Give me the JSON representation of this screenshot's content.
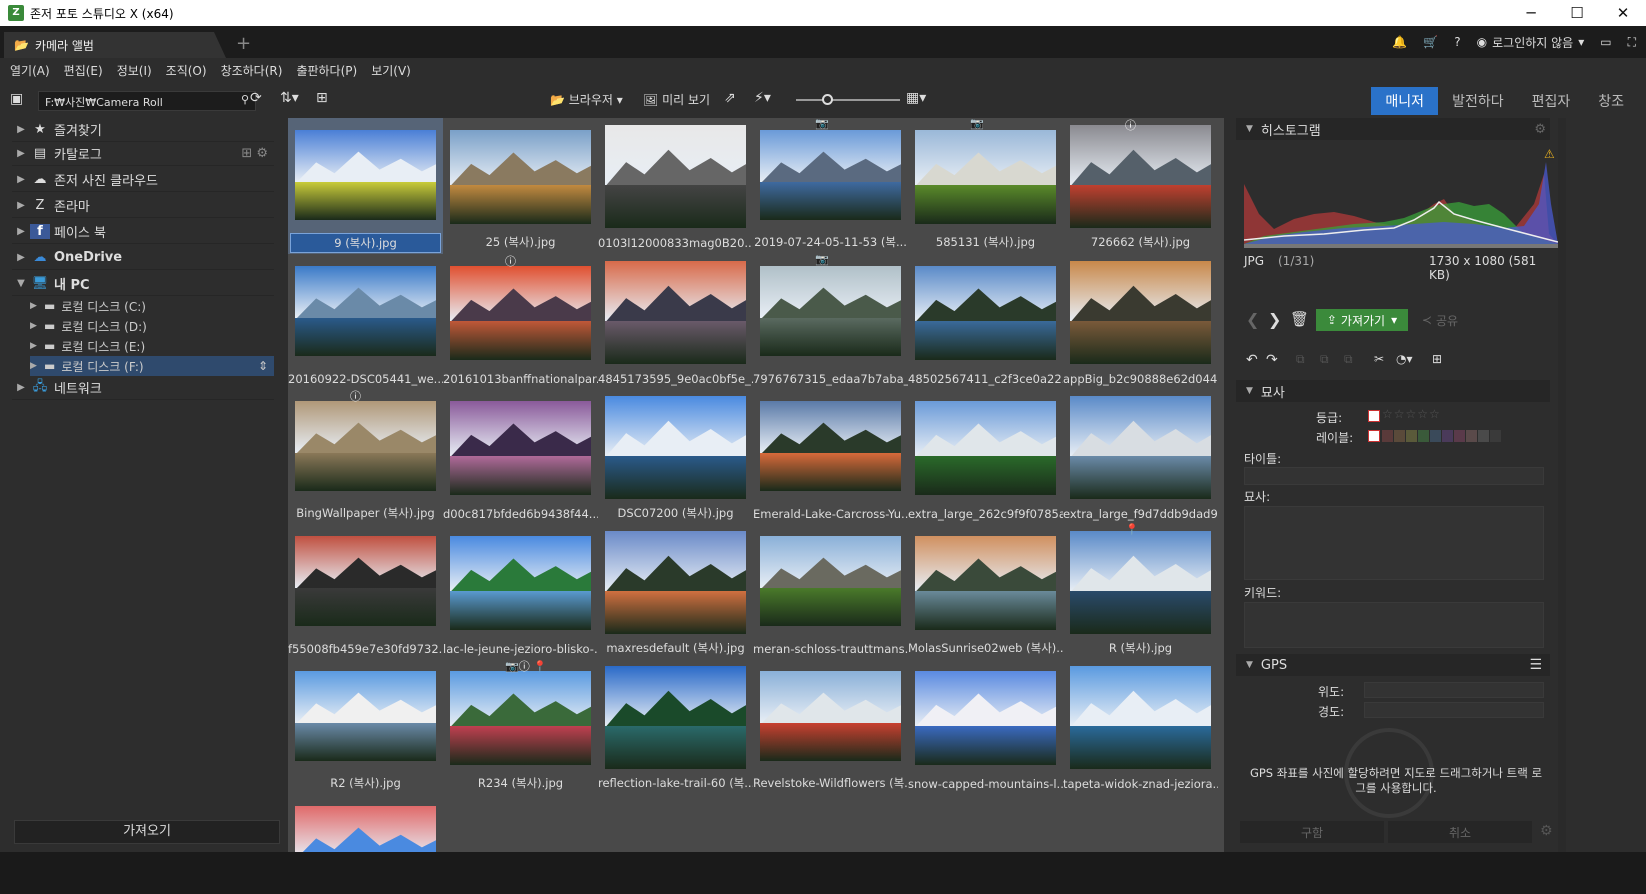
{
  "app": {
    "title": "존저 포토 스튜디오 X (x64)",
    "tab": "카메라 앨범",
    "login": "로그인하지 않음"
  },
  "menu": [
    "열기(A)",
    "편집(E)",
    "정보(I)",
    "조직(O)",
    "창조하다(R)",
    "출판하다(P)",
    "보기(V)"
  ],
  "toolbar": {
    "path": "F:₩사진₩Camera Roll",
    "browser": "브라우저",
    "preview": "미리 보기"
  },
  "modes": [
    "매니저",
    "발전하다",
    "편집자",
    "창조"
  ],
  "tree": [
    {
      "label": "즐겨찾기",
      "icon": "star-icon"
    },
    {
      "label": "카탈로그",
      "icon": "catalog-icon"
    },
    {
      "label": "존저 사진 클라우드",
      "icon": "cloud-icon"
    },
    {
      "label": "존라마",
      "icon": "zonerama-icon"
    },
    {
      "label": "페이스 북",
      "icon": "facebook-icon"
    },
    {
      "label": "OneDrive",
      "icon": "onedrive-icon"
    },
    {
      "label": "내 PC",
      "icon": "pc-icon"
    }
  ],
  "drives": [
    "로컬 디스크 (C:)",
    "로컬 디스크 (D:)",
    "로컬 디스크 (E:)",
    "로컬 디스크 (F:)"
  ],
  "network": "네트워크",
  "import_label": "가져오기",
  "photos": [
    {
      "name": "9 (복사).jpg",
      "c": [
        "#4a7fd6",
        "#e8eef5",
        "#c9cc3a"
      ],
      "badge": ""
    },
    {
      "name": "25 (복사).jpg",
      "c": [
        "#7aa0c8",
        "#8a7a60",
        "#c28a40"
      ],
      "badge": ""
    },
    {
      "name": "0103l12000833mag0B20...",
      "c": [
        "#e8e8e8",
        "#666666",
        "#444444"
      ],
      "badge": ""
    },
    {
      "name": "2019-07-24-05-11-53 (복...",
      "c": [
        "#6a9ad8",
        "#5a6a80",
        "#3f6aa0"
      ],
      "badge": "📷"
    },
    {
      "name": "585131 (복사).jpg",
      "c": [
        "#9ab8d8",
        "#d8d8d0",
        "#5a8a2a"
      ],
      "badge": "📷"
    },
    {
      "name": "726662 (복사).jpg",
      "c": [
        "#8a8a90",
        "#55606a",
        "#c04030"
      ],
      "badge": "ⓘ"
    },
    {
      "name": "20160922-DSC05441_we...",
      "c": [
        "#3a7ac8",
        "#6a8aa8",
        "#2a5a8a"
      ],
      "badge": ""
    },
    {
      "name": "20161013banffnationalpar...",
      "c": [
        "#e05030",
        "#4a3a4a",
        "#c05838"
      ],
      "badge": "ⓘ"
    },
    {
      "name": "4845173595_9e0ac0bf5e_...",
      "c": [
        "#d86a4a",
        "#3a3a4a",
        "#6a5a6a"
      ],
      "badge": ""
    },
    {
      "name": "7976767315_edaa7b7aba_...",
      "c": [
        "#b0c0c8",
        "#4a5a4a",
        "#5a6a60"
      ],
      "badge": "📷"
    },
    {
      "name": "48502567411_c2f3ce0a22...",
      "c": [
        "#5a8ac8",
        "#2a3a2a",
        "#3a6a9a"
      ],
      "badge": ""
    },
    {
      "name": "appBig_b2c90888e62d044...",
      "c": [
        "#c8884a",
        "#3a3a30",
        "#7a5a3a"
      ],
      "badge": ""
    },
    {
      "name": "BingWallpaper (복사).jpg",
      "c": [
        "#b09878",
        "#9a8868",
        "#8a7858"
      ],
      "badge": "ⓘ"
    },
    {
      "name": "d00c817bfded6b9438f44...",
      "c": [
        "#8a5a9a",
        "#3a2a4a",
        "#b06a9a"
      ],
      "badge": ""
    },
    {
      "name": "DSC07200 (복사).jpg",
      "c": [
        "#4a8ae0",
        "#e8eef5",
        "#2a5a8a"
      ],
      "badge": ""
    },
    {
      "name": "Emerald-Lake-Carcross-Yu...",
      "c": [
        "#5a7aa8",
        "#2a3a2a",
        "#d86a3a"
      ],
      "badge": ""
    },
    {
      "name": "extra_large_262c9f9f0785a...",
      "c": [
        "#6a9ad8",
        "#e0e6ea",
        "#2a6a2a"
      ],
      "badge": ""
    },
    {
      "name": "extra_large_f9d7ddb9dad9...",
      "c": [
        "#5a8ac8",
        "#d8dde2",
        "#6a8aa8"
      ],
      "badge": ""
    },
    {
      "name": "f55008fb459e7e30fd9732...",
      "c": [
        "#c05040",
        "#2a2a2a",
        "#3a3a3a"
      ],
      "badge": ""
    },
    {
      "name": "lac-le-jeune-jezioro-blisko-...",
      "c": [
        "#4a8ae0",
        "#2a7a3a",
        "#5a9ad0"
      ],
      "badge": ""
    },
    {
      "name": "maxresdefault (복사).jpg",
      "c": [
        "#6a8ac8",
        "#2a3a2a",
        "#d07040"
      ],
      "badge": ""
    },
    {
      "name": "meran-schloss-trauttmans...",
      "c": [
        "#8ab0d8",
        "#6a6a60",
        "#4a7a2a"
      ],
      "badge": ""
    },
    {
      "name": "MolasSunrise02web (복사)...",
      "c": [
        "#d09060",
        "#3a4a3a",
        "#6a8a9a"
      ],
      "badge": ""
    },
    {
      "name": "R (복사).jpg",
      "c": [
        "#5a8ac8",
        "#e0e6ea",
        "#2a4a6a"
      ],
      "badge": "📍"
    },
    {
      "name": "R2 (복사).jpg",
      "c": [
        "#5a9ae0",
        "#f0f0f0",
        "#6a8aa8"
      ],
      "badge": ""
    },
    {
      "name": "R234 (복사).jpg",
      "c": [
        "#5a9ae0",
        "#3a6a3a",
        "#c04050"
      ],
      "badge": "📷ⓘ 📍"
    },
    {
      "name": "reflection-lake-trail-60 (복...",
      "c": [
        "#2a6ac8",
        "#1a4a2a",
        "#2a6a6a"
      ],
      "badge": ""
    },
    {
      "name": "Revelstoke-Wildflowers (복...",
      "c": [
        "#8ab0d8",
        "#e0e6ea",
        "#c84030"
      ],
      "badge": ""
    },
    {
      "name": "snow-capped-mountains-l...",
      "c": [
        "#5a8ae0",
        "#f0f0f5",
        "#3a6ac0"
      ],
      "badge": ""
    },
    {
      "name": "tapeta-widok-znad-jeziora...",
      "c": [
        "#5a9ae0",
        "#e8eef5",
        "#2a6a9a"
      ],
      "badge": ""
    },
    {
      "name": "",
      "c": [
        "#e06a6a",
        "#4a8ae0",
        "#3a7ad0"
      ],
      "badge": ""
    }
  ],
  "right": {
    "histogram": "히스토그램",
    "format": "JPG",
    "index": "(1/31)",
    "dims": "1730 x 1080 (581 KB)",
    "export": "가져가기",
    "share": "공유",
    "desc_section": "묘사",
    "rating": "등급:",
    "label": "레이블:",
    "title": "타이틀:",
    "description": "묘사:",
    "keywords": "키워드:",
    "gps_section": "GPS",
    "lat": "위도:",
    "lon": "경도:",
    "gps_hint": "GPS 좌표를 사진에 할당하려면 지도로 드래그하거나 트랙 로그를 사용합니다.",
    "save": "구함",
    "cancel": "취소"
  },
  "colors": {
    "accent": "#2a72c9",
    "export_green": "#3b8a3b"
  }
}
